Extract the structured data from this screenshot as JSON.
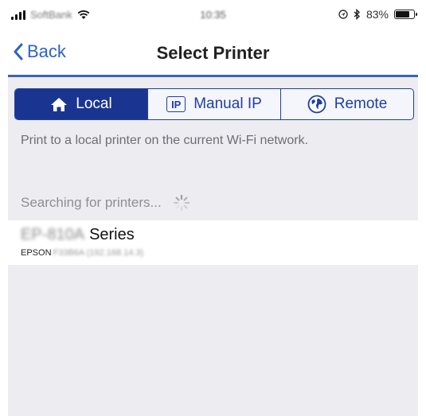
{
  "status_bar": {
    "carrier": "SoftBank",
    "time": "10:35",
    "battery_percent": "83%",
    "battery_level": 0.83,
    "icons": [
      "signal-icon",
      "wifi-icon",
      "location-icon",
      "bluetooth-icon",
      "battery-icon"
    ]
  },
  "nav": {
    "back_label": "Back",
    "title": "Select Printer"
  },
  "tabs": [
    {
      "label": "Local",
      "icon": "home-icon",
      "active": true
    },
    {
      "label": "Manual IP",
      "icon": "ip-icon",
      "icon_text": "IP",
      "active": false
    },
    {
      "label": "Remote",
      "icon": "globe-icon",
      "active": false
    }
  ],
  "description": "Print to a local printer on the current Wi-Fi network.",
  "searching_text": "Searching for printers...",
  "printer": {
    "model_prefix": "EP-810A",
    "model_suffix": "Series",
    "name_prefix": "EPSON",
    "name_suffix": "F33B6A (192.168.14.3)"
  },
  "colors": {
    "accent": "#1a3591",
    "link": "#2b63c8",
    "background": "#ececf1"
  }
}
